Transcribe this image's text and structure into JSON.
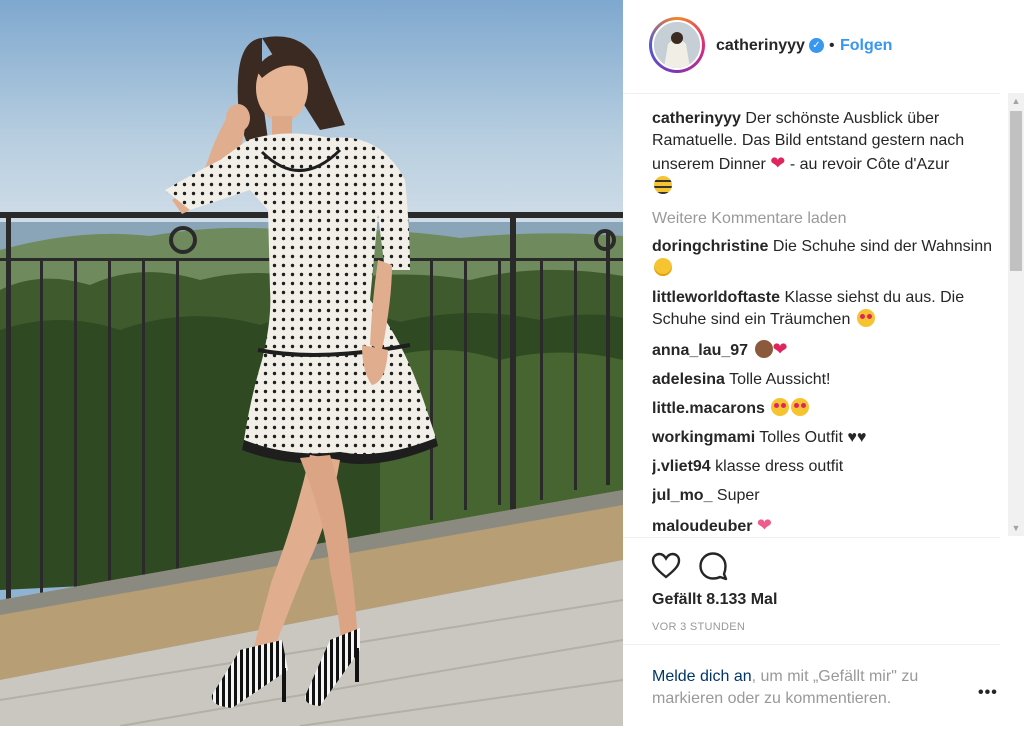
{
  "post": {
    "username": "catherinyyy",
    "separator": "•",
    "follow_label": "Folgen",
    "caption_text": " Der schönste Ausblick über Ramatuelle. Das Bild entstand gestern nach unserem Dinner ",
    "caption_text_end": " - au revoir Côte d'Azur",
    "load_more_label": "Weitere Kommentare laden",
    "comments": [
      {
        "user": "doringchristine",
        "text": " Die Schuhe sind der Wahnsinn ",
        "emoji": "smile"
      },
      {
        "user": "littleworldoftaste",
        "text": " Klasse siehst du aus. Die Schuhe sind ein Träumchen ",
        "emoji": "heart-eyes"
      },
      {
        "user": "anna_lau_97",
        "text": " ",
        "emoji": "monkey-heart"
      },
      {
        "user": "adelesina",
        "text": " Tolle Aussicht!",
        "emoji": ""
      },
      {
        "user": "little.macarons",
        "text": " ",
        "emoji": "heart-eyes-x2"
      },
      {
        "user": "workingmami",
        "text": " Tolles Outfit ♥♥",
        "emoji": ""
      },
      {
        "user": "j.vliet94",
        "text": " klasse dress outfit",
        "emoji": ""
      },
      {
        "user": "jul_mo_",
        "text": " Super",
        "emoji": ""
      },
      {
        "user": "maloudeuber",
        "text": " ",
        "emoji": "pink-heart"
      }
    ],
    "likes_label": "Gefällt 8.133 Mal",
    "timestamp": "VOR 3 STUNDEN",
    "login_link": "Melde dich an",
    "login_text": ", um mit „Gefällt mir\" zu markieren oder zu kommentieren.",
    "more_dots": "•••"
  },
  "colors": {
    "accent": "#3897f0",
    "text": "#262626",
    "muted": "#999999",
    "heart": "#e0245e"
  }
}
